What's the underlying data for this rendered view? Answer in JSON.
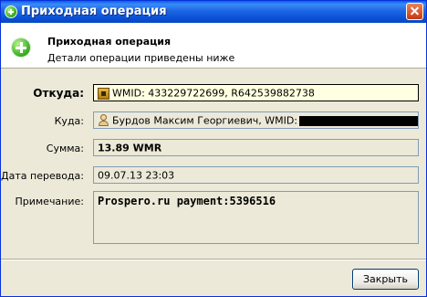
{
  "window": {
    "title": "Приходная операция"
  },
  "header": {
    "title": "Приходная операция",
    "subtitle": "Детали операции приведены ниже"
  },
  "fields": {
    "from": {
      "label": "Откуда:",
      "value": "WMID: 433229722699, R642539882738",
      "icon": "webmoney-purse-icon"
    },
    "to": {
      "label": "Куда:",
      "value": "Бурдов Максим Георгиевич, WMID:",
      "icon": "person-icon"
    },
    "amount": {
      "label": "Сумма:",
      "value": "13.89 WMR"
    },
    "date": {
      "label": "Дата перевода:",
      "value": "09.07.13 23:03"
    },
    "note": {
      "label": "Примечание:",
      "value": "Prospero.ru payment:5396516"
    }
  },
  "buttons": {
    "close_label": "Закрыть"
  },
  "colors": {
    "titlebar": "#0a4fd4",
    "dialog_bg": "#ece9d8",
    "focused_field_bg": "#ffffe1"
  }
}
